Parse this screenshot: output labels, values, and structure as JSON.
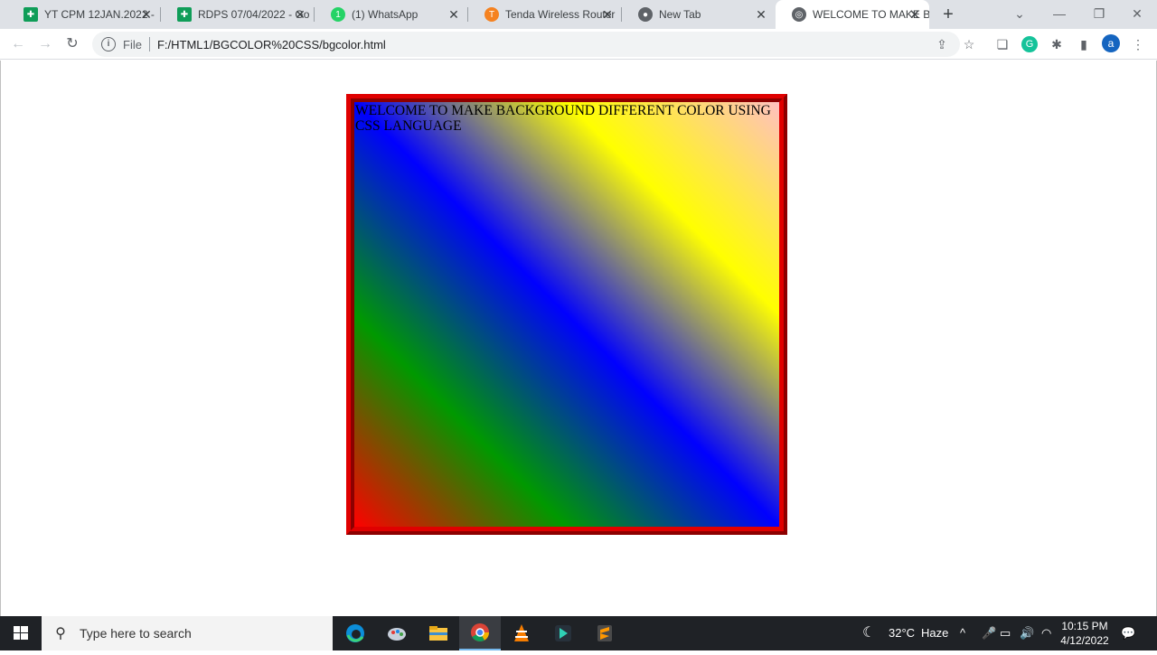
{
  "tabs": [
    {
      "title": "YT CPM 12JAN.2022 -",
      "icon": "sheets-icon",
      "color": "#0f9d58"
    },
    {
      "title": "RDPS 07/04/2022 - Go",
      "icon": "sheets-icon",
      "color": "#0f9d58"
    },
    {
      "title": "(1) WhatsApp",
      "icon": "whatsapp-icon",
      "color": "#25d366"
    },
    {
      "title": "Tenda Wireless Router",
      "icon": "tenda-icon",
      "color": "#f58220"
    },
    {
      "title": "New Tab",
      "icon": "chrome-icon",
      "color": "#5f6368"
    },
    {
      "title": "WELCOME TO MAKE B",
      "icon": "globe-icon",
      "color": "#5f6368"
    }
  ],
  "toolbar": {
    "scheme": "File",
    "url": "F:/HTML1/BGCOLOR%20CSS/bgcolor.html",
    "avatar_letter": "a"
  },
  "page": {
    "text": "WELCOME TO MAKE BACKGROUND DIFFERENT COLOR USING CSS LANGUAGE",
    "border_color": "#e00000",
    "gradient_colors": [
      "#ff0000",
      "#009900",
      "#0000ff",
      "#ffff00",
      "#ffc0c0"
    ]
  },
  "taskbar": {
    "search_placeholder": "Type here to search",
    "weather_temp": "32°C",
    "weather_desc": "Haze",
    "time": "10:15 PM",
    "date": "4/12/2022"
  }
}
